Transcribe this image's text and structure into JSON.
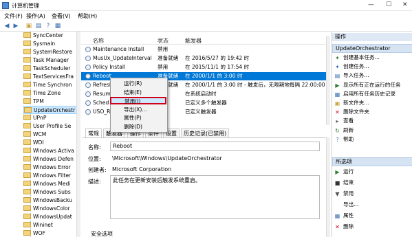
{
  "window": {
    "title": "计算机管理",
    "min": "—",
    "max": "☐",
    "close": "✕"
  },
  "menubar": [
    "文件(F)",
    "操作(A)",
    "查看(V)",
    "帮助(H)"
  ],
  "tree": {
    "items": [
      "SyncCenter",
      "Sysmain",
      "SystemRestore",
      "Task Manager",
      "TaskScheduler",
      "TextServicesFra",
      "Time Synchron",
      "Time Zone",
      "TPM",
      "UpdateOrchestr",
      "UPnP",
      "User Profile Se",
      "WCM",
      "WDI",
      "Windows Activa",
      "Windows Defen",
      "Windows Error",
      "Windows Filter",
      "Windows Medi",
      "Windows Subs",
      "WindowsBacku",
      "WindowsColor",
      "WindowsUpdat",
      "Wininet",
      "WOF"
    ],
    "selected_index": 9
  },
  "task_list": {
    "columns": [
      "名称",
      "状态",
      "触发器"
    ],
    "rows": [
      {
        "name": "Maintenance Install",
        "status": "禁用",
        "trigger": ""
      },
      {
        "name": "MusUx_UpdateInterval",
        "status": "准备就绪",
        "trigger": "在 2016/5/27 的 19:42 时"
      },
      {
        "name": "Policy Install",
        "status": "禁用",
        "trigger": "在 2015/11/1 的 17:54 时"
      },
      {
        "name": "Reboot",
        "status": "准备就绪",
        "trigger": "在 2000/1/1 的 3:00 时"
      },
      {
        "name": "Refresh",
        "status": "准备就绪",
        "trigger": "在 2000/1/1 的 3:00 时 - 触发后，无限期地每隔 22:00:00 重"
      },
      {
        "name": "Resum",
        "status": "",
        "trigger": "在系统启动时"
      },
      {
        "name": "Sched",
        "status": "",
        "trigger": "已定义多个触发器"
      },
      {
        "name": "USO_R",
        "status": "",
        "trigger": "已定义触发器"
      }
    ],
    "selected_index": 3
  },
  "context_menu": {
    "items": [
      "运行(R)",
      "结束(E)",
      "禁用(I)",
      "导出(X)...",
      "属性(P)",
      "删除(D)"
    ],
    "highlighted_index": 2
  },
  "detail": {
    "tabs": [
      "常规",
      "触发器",
      "操作",
      "条件",
      "设置",
      "历史记录(已禁用)"
    ],
    "name_label": "名称:",
    "name_value": "Reboot",
    "location_label": "位置:",
    "location_value": "\\Microsoft\\Windows\\UpdateOrchestrator",
    "author_label": "创建者:",
    "author_value": "Microsoft Corporation",
    "desc_label": "描述:",
    "desc_value": "此任务在更新安装后触发系统重启。",
    "security_label": "安全选项"
  },
  "actions": {
    "title": "操作",
    "section1": "UpdateOrchestrator",
    "section1_items": [
      "创建基本任务...",
      "创建任务...",
      "导入任务...",
      "显示所有正在运行的任务",
      "启用所有任务历史记录",
      "新文件夹...",
      "删除文件夹",
      "查看",
      "刷新",
      "帮助"
    ],
    "section2": "所选项",
    "section2_items": [
      "运行",
      "结束",
      "禁用",
      "导出...",
      "属性",
      "删除"
    ]
  },
  "colors": {
    "selection": "#0078d7",
    "highlight_border": "#d0021b",
    "tree_selected": "#cce8ff"
  }
}
